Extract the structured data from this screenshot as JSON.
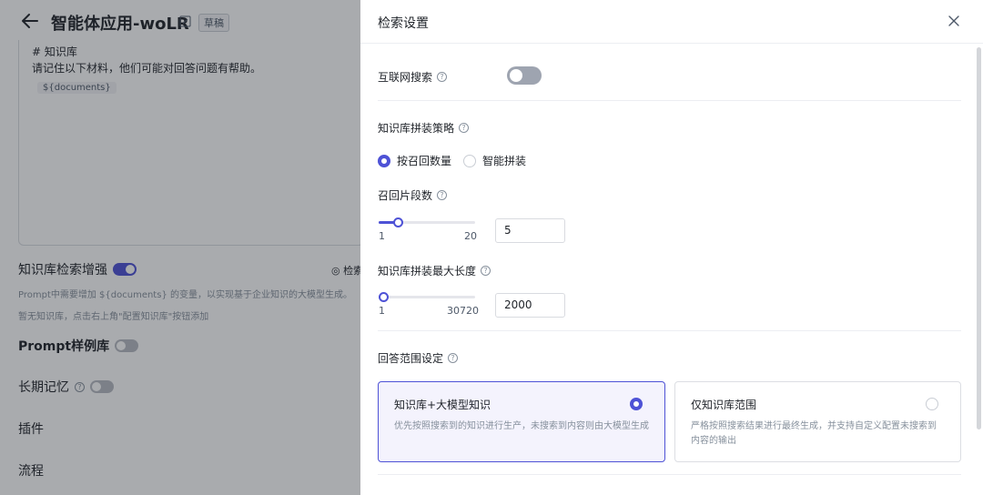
{
  "background": {
    "app_title": "智能体应用-woLR",
    "draft_badge": "草稿",
    "prompt": {
      "line1": "# 知识库",
      "line2": "请记住以下材料，他们可能对回答问题有帮助。",
      "variable": "${documents}"
    },
    "kb_enhance_label": "知识库检索增强",
    "retrieve_settings_label": "◎ 检索",
    "kb_desc": "Prompt中需要增加 ${documents} 的变量，以实现基于企业知识的大模型生成。",
    "kb_empty": "暂无知识库，点击右上角\"配置知识库\"按钮添加",
    "sections": {
      "prompt_examples": "Prompt样例库",
      "long_memory": "长期记忆",
      "plugins": "插件",
      "flow": "流程"
    }
  },
  "drawer": {
    "title": "检索设置",
    "web_search_label": "互联网搜索",
    "web_search_enabled": false,
    "strategy_label": "知识库拼装策略",
    "strategy_options": [
      "按召回数量",
      "智能拼装"
    ],
    "strategy_selected": "按召回数量",
    "recall_count": {
      "label": "召回片段数",
      "min": "1",
      "max": "20",
      "value": "5"
    },
    "max_length": {
      "label": "知识库拼装最大长度",
      "min": "1",
      "max": "30720",
      "value": "2000"
    },
    "scope_label": "回答范围设定",
    "scope_options": [
      {
        "title": "知识库+大模型知识",
        "desc": "优先按照搜索到的知识进行生产，未搜索到内容则由大模型生成",
        "selected": true
      },
      {
        "title": "仅知识库范围",
        "desc": "严格按照搜索结果进行最终生成，并支持自定义配置未搜索到内容的输出",
        "selected": false
      }
    ]
  },
  "colors": {
    "accent": "#4e52d6",
    "overlay": "#1d2129"
  }
}
